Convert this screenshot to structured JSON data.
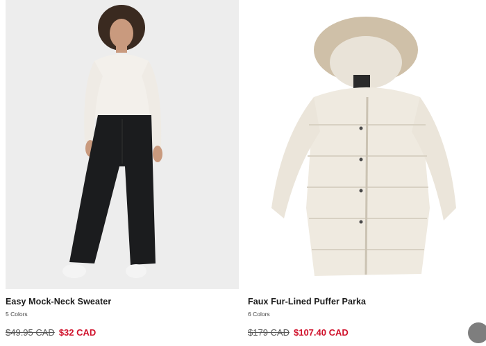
{
  "colors": {
    "sale": "#d0112b",
    "card_bg": "#ededed"
  },
  "products": [
    {
      "name": "Easy Mock-Neck Sweater",
      "colors_count": "5 Colors",
      "original_price": "$49.95 CAD",
      "sale_price": "$32 CAD",
      "image_icon": "model-sweater-photo"
    },
    {
      "name": "Faux Fur-Lined Puffer Parka",
      "colors_count": "6 Colors",
      "original_price": "$179 CAD",
      "sale_price": "$107.40 CAD",
      "image_icon": "puffer-parka-photo"
    }
  ]
}
